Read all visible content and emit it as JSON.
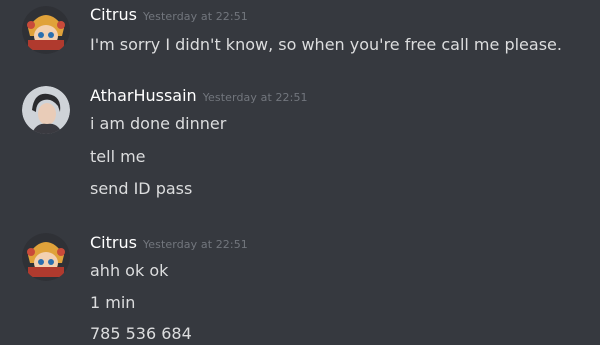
{
  "messages": [
    {
      "author": "Citrus",
      "timestamp": "Yesterday at 22:51",
      "lines": [
        "I'm sorry I didn't know, so when you're free call me please."
      ]
    },
    {
      "author": "AtharHussain",
      "timestamp": "Yesterday at 22:51",
      "lines": [
        "i am done dinner",
        "tell me",
        "send ID pass"
      ]
    },
    {
      "author": "Citrus",
      "timestamp": "Yesterday at 22:51",
      "lines": [
        "ahh ok ok",
        "1 min",
        "785 536 684"
      ]
    }
  ]
}
